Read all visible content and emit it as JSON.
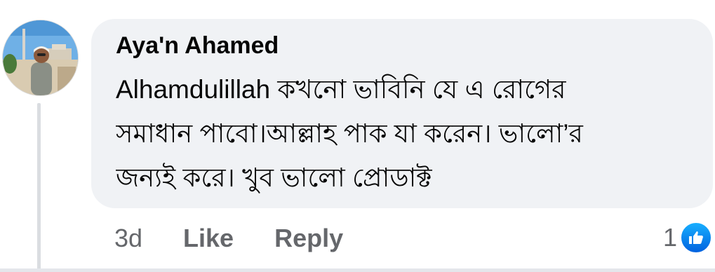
{
  "comment": {
    "author": "Aya'n Ahamed",
    "lines": [
      "Alhamdulillah কখনো ভাবিনি যে এ রোগের",
      "সমাধান পাবো।আল্লাহ পাক যা করেন। ভালো’র",
      "জন্যই করে। খুব ভালো প্রোডাক্ট"
    ],
    "timestamp": "3d",
    "like_label": "Like",
    "reply_label": "Reply",
    "reaction_count": "1",
    "reaction_icon": "thumbs-up-icon"
  },
  "colors": {
    "bubble": "#f0f2f5",
    "text": "#050505",
    "secondary_text": "#65676b",
    "like_blue": "#0866ff"
  }
}
